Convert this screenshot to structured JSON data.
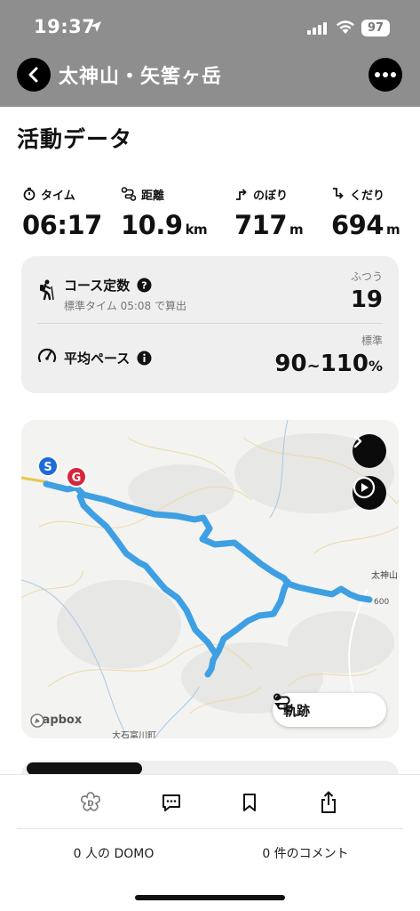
{
  "status_bar": {
    "time": "19:37",
    "battery": "97"
  },
  "nav": {
    "title": "太神山・矢筈ヶ岳"
  },
  "section": {
    "title": "活動データ"
  },
  "stats": [
    {
      "label": "タイム",
      "value": "06:17",
      "unit": "",
      "icon": "stopwatch-icon"
    },
    {
      "label": "距離",
      "value": "10.9",
      "unit": "km",
      "icon": "route-icon"
    },
    {
      "label": "のぼり",
      "value": "717",
      "unit": "m",
      "icon": "ascent-icon"
    },
    {
      "label": "くだり",
      "value": "694",
      "unit": "m",
      "icon": "descent-icon"
    }
  ],
  "course": {
    "label": "コース定数",
    "sub": "標準タイム 05:08 で算出",
    "rating_label": "ふつう",
    "value": "19"
  },
  "pace": {
    "label": "平均ペース",
    "rating_label": "標準",
    "value_low": "90",
    "tilde": "~",
    "value_high": "110",
    "unit": "%"
  },
  "map": {
    "start_marker": "S",
    "goal_marker": "G",
    "peak_label": "太神山",
    "elevation_label": "600",
    "town_label": "大石富川町",
    "attribution": "mapbox",
    "track_toggle_label": "軌跡",
    "track_color": "#3f9fe3"
  },
  "bottom": {
    "domo_count": "0 人の DOMO",
    "comment_count": "0 件のコメント"
  }
}
